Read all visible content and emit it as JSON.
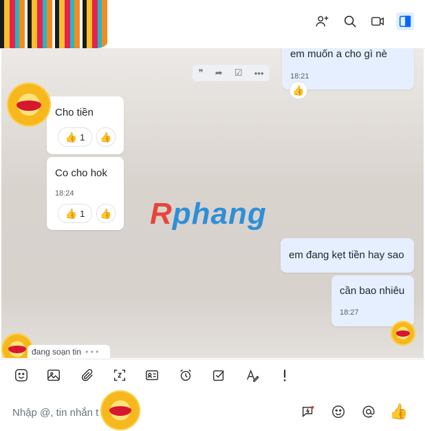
{
  "header": {
    "avatar_name": "avatar",
    "icons": [
      "add-member-icon",
      "search-icon",
      "video-call-icon",
      "sidebar-toggle-icon"
    ]
  },
  "chat": {
    "watermark_first": "R",
    "watermark_rest": "phang",
    "messages": [
      {
        "side": "me",
        "text": "em muốn a cho gì nè",
        "time": "18:21"
      },
      {
        "side": "them",
        "text": "Cho tiền",
        "reaction_count": "1"
      },
      {
        "side": "them",
        "text": "Co cho hok",
        "time": "18:24",
        "reaction_count": "1"
      },
      {
        "side": "me",
        "text": "em đang kẹt tiền hay sao"
      },
      {
        "side": "me",
        "text": "cần bao nhiêu",
        "time": "18:27"
      }
    ],
    "hover_toolbar": [
      "quote-icon",
      "forward-icon",
      "mark-task-icon",
      "more-icon"
    ],
    "typing_status": "đang soạn tin"
  },
  "composer": {
    "tools": [
      "sticker-icon",
      "image-icon",
      "attach-icon",
      "screenshot-icon",
      "contact-card-icon",
      "reminder-icon",
      "task-icon",
      "format-text-icon",
      "urgent-icon"
    ],
    "placeholder": "Nhập @, tin nhắn t",
    "right_icons": [
      "quick-message-icon",
      "emoji-icon",
      "mention-icon",
      "like-icon"
    ]
  },
  "colors": {
    "my_bubble": "#e5efff",
    "their_bubble": "#ffffff",
    "accent": "#0068ff"
  }
}
